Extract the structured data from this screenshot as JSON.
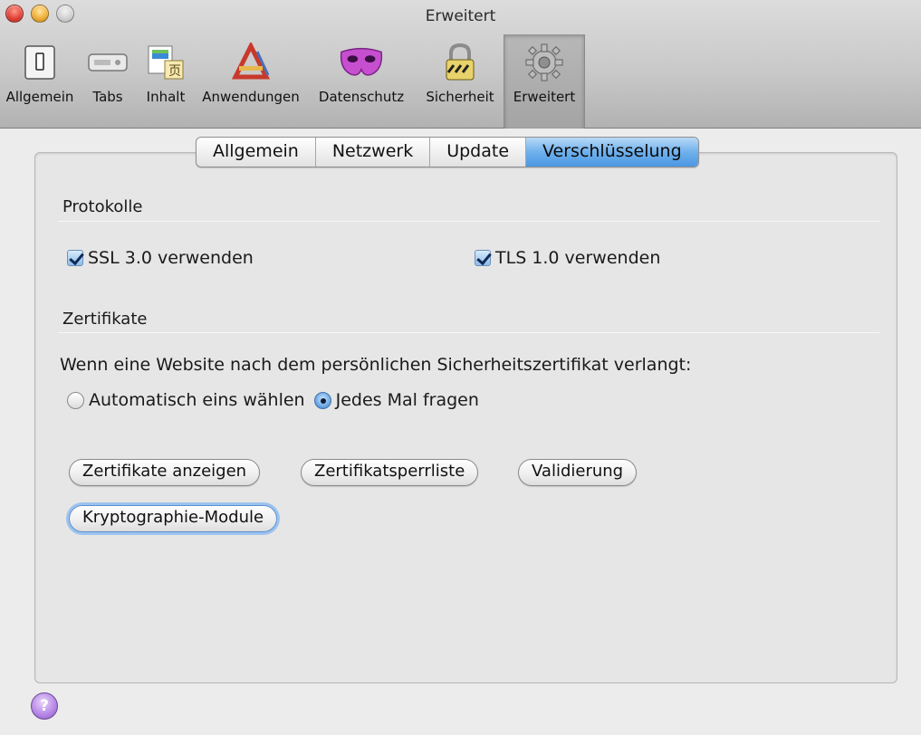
{
  "window": {
    "title": "Erweitert",
    "traffic_lights": {
      "close": "#e0443a",
      "minimize": "#f0b03a",
      "zoom": "#cfcfcf"
    }
  },
  "toolbar": {
    "items": [
      {
        "label": "Allgemein",
        "icon": "switch-icon"
      },
      {
        "label": "Tabs",
        "icon": "tabs-icon"
      },
      {
        "label": "Inhalt",
        "icon": "content-icon"
      },
      {
        "label": "Anwendungen",
        "icon": "applications-icon"
      },
      {
        "label": "Datenschutz",
        "icon": "mask-icon"
      },
      {
        "label": "Sicherheit",
        "icon": "lock-icon"
      },
      {
        "label": "Erweitert",
        "icon": "gear-icon",
        "selected": true
      }
    ]
  },
  "tabs": [
    {
      "label": "Allgemein"
    },
    {
      "label": "Netzwerk"
    },
    {
      "label": "Update"
    },
    {
      "label": "Verschlüsselung",
      "active": true
    }
  ],
  "protocols": {
    "heading": "Protokolle",
    "ssl_label": "SSL 3.0 verwenden",
    "tls_label": "TLS 1.0 verwenden",
    "ssl_checked": true,
    "tls_checked": true
  },
  "certificates": {
    "heading": "Zertifikate",
    "description": "Wenn eine Website nach dem persönlichen Sicherheitszertifikat verlangt:",
    "radio_auto": "Automatisch eins wählen",
    "radio_ask": "Jedes Mal fragen",
    "selected": "Jedes Mal fragen",
    "buttons": {
      "show": "Zertifikate anzeigen",
      "revocation": "Zertifikatsperrliste",
      "validation": "Validierung",
      "crypto": "Kryptographie-Module"
    }
  },
  "help": {
    "label": "?"
  },
  "colors": {
    "accent": "#6fb0ec",
    "help": "#b98ae6"
  }
}
